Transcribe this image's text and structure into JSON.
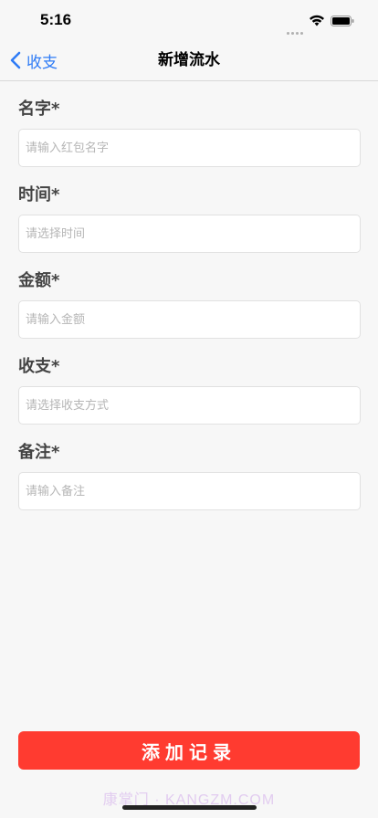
{
  "status_bar": {
    "time": "5:16"
  },
  "nav": {
    "back_label": "收支",
    "title": "新增流水"
  },
  "fields": [
    {
      "label": "名字*",
      "placeholder": "请输入红包名字",
      "value": ""
    },
    {
      "label": "时间*",
      "placeholder": "请选择时间",
      "value": ""
    },
    {
      "label": "金额*",
      "placeholder": "请输入金额",
      "value": ""
    },
    {
      "label": "收支*",
      "placeholder": "请选择收支方式",
      "value": ""
    },
    {
      "label": "备注*",
      "placeholder": "请输入备注",
      "value": ""
    }
  ],
  "submit_label": "添加记录",
  "watermark": "康掌门 · KANGZM.COM",
  "colors": {
    "accent": "#2f7cf6",
    "submit_bg": "#ff3b30",
    "background": "#f7f7f7"
  }
}
